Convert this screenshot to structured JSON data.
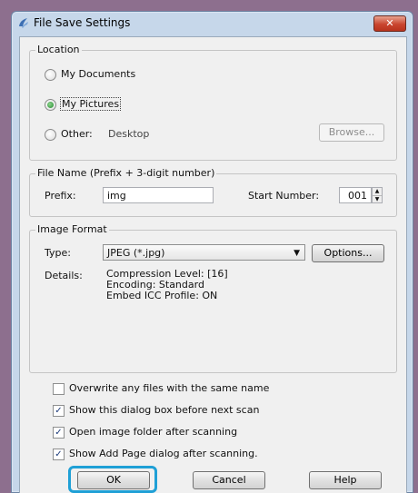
{
  "window": {
    "title": "File Save Settings",
    "close_label": "✕"
  },
  "location": {
    "legend": "Location",
    "my_documents": "My Documents",
    "my_pictures": "My Pictures",
    "other": "Other:",
    "other_path": "Desktop",
    "browse": "Browse...",
    "selected": "my_pictures"
  },
  "file_name": {
    "legend": "File Name (Prefix + 3-digit number)",
    "prefix_label": "Prefix:",
    "prefix_value": "img",
    "start_label": "Start Number:",
    "start_value": "001"
  },
  "image_format": {
    "legend": "Image Format",
    "type_label": "Type:",
    "type_value": "JPEG (*.jpg)",
    "options": "Options...",
    "details_label": "Details:",
    "details": [
      "Compression Level: [16]",
      "Encoding: Standard",
      "Embed ICC Profile: ON"
    ]
  },
  "checkboxes": [
    {
      "label": "Overwrite any files with the same name",
      "checked": false
    },
    {
      "label": "Show this dialog box before next scan",
      "checked": true
    },
    {
      "label": "Open image folder after scanning",
      "checked": true
    },
    {
      "label": "Show Add Page dialog after scanning.",
      "checked": true
    }
  ],
  "buttons": {
    "ok": "OK",
    "cancel": "Cancel",
    "help": "Help"
  },
  "colors": {
    "focus_ring": "#1fa0d6",
    "title_bar": "#c6d7ea",
    "close": "#c9452f"
  }
}
